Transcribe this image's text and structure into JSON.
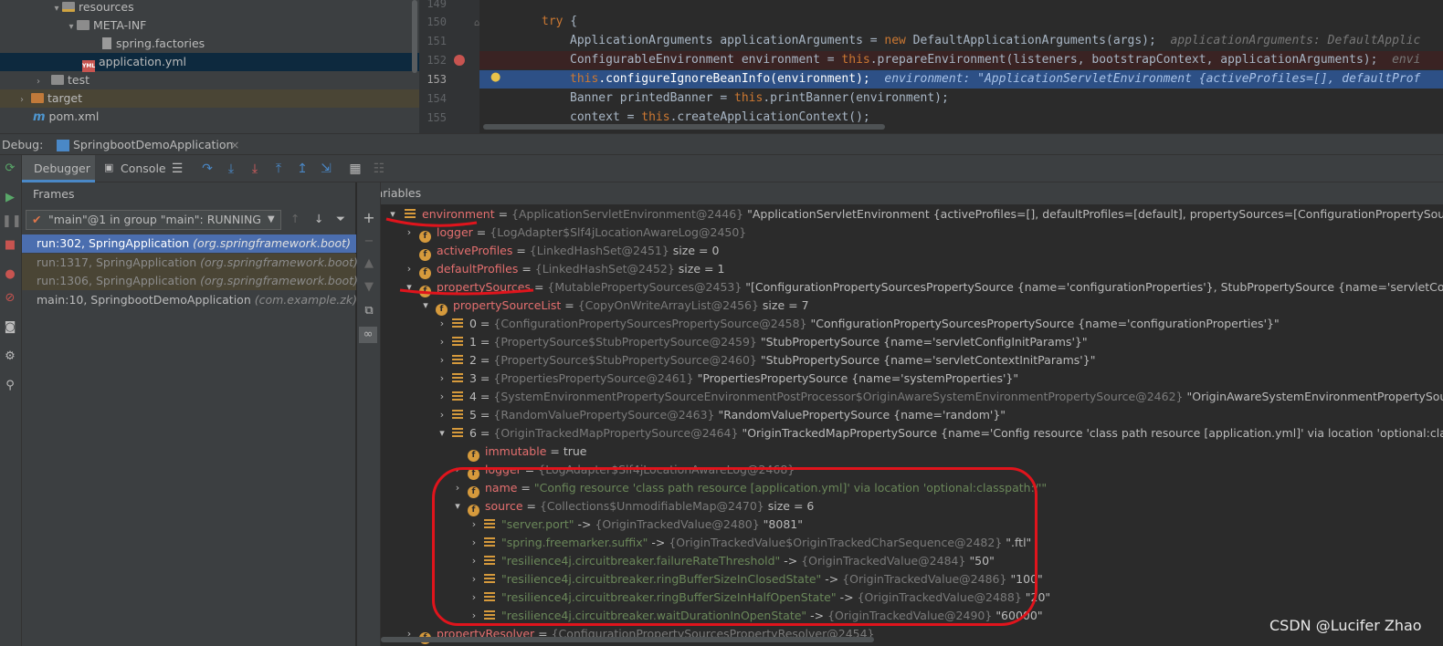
{
  "project_tree": {
    "resources": "resources",
    "meta_inf": "META-INF",
    "spring_factories": "spring.factories",
    "application_yml": "application.yml",
    "test": "test",
    "target": "target",
    "pom": "pom.xml"
  },
  "editor": {
    "lines": [
      "149",
      "150",
      "151",
      "152",
      "153",
      "154",
      "155"
    ],
    "code": {
      "l150_kw": "try",
      "l150_rest": " {",
      "l151": "ApplicationArguments applicationArguments = ",
      "l151_new": "new",
      "l151_rest": " DefaultApplicationArguments(args);",
      "l151_hint": "  applicationArguments: DefaultApplic",
      "l152": "ConfigurableEnvironment environment = ",
      "l152_this": "this",
      "l152_rest": ".prepareEnvironment(listeners, bootstrapContext, applicationArguments);",
      "l152_hint": "  envi",
      "l153_this": "this",
      "l153_rest": ".configureIgnoreBeanInfo(environment);",
      "l153_hint": "  environment: \"ApplicationServletEnvironment {activeProfiles=[], defaultProf",
      "l154": "Banner printedBanner = ",
      "l154_this": "this",
      "l154_rest": ".printBanner(environment);",
      "l155": "context = ",
      "l155_this": "this",
      "l155_rest": ".createApplicationContext();"
    }
  },
  "debug": {
    "label": "Debug:",
    "tab": "SpringbootDemoApplication",
    "debugger_tab": "Debugger",
    "console_tab": "Console"
  },
  "frames": {
    "header": "Frames",
    "thread": "\"main\"@1 in group \"main\": RUNNING",
    "items": [
      {
        "method": "run:302, SpringApplication",
        "pkg": "(org.springframework.boot)"
      },
      {
        "method": "run:1317, SpringApplication",
        "pkg": "(org.springframework.boot)"
      },
      {
        "method": "run:1306, SpringApplication",
        "pkg": "(org.springframework.boot)"
      },
      {
        "method": "main:10, SpringbootDemoApplication",
        "pkg": "(com.example.zk)"
      }
    ]
  },
  "variables": {
    "header": "Variables",
    "rows": [
      {
        "name": "environment",
        "type": "{ApplicationServletEnvironment@2446}",
        "value": "\"ApplicationServletEnvironment {activeProfiles=[], defaultProfiles=[default], propertySources=[ConfigurationPropertySourcesPropertySourc"
      },
      {
        "name": "logger",
        "type": "{LogAdapter$Slf4jLocationAwareLog@2450}",
        "value": ""
      },
      {
        "name": "activeProfiles",
        "type": "{LinkedHashSet@2451}",
        "value": " size = 0"
      },
      {
        "name": "defaultProfiles",
        "type": "{LinkedHashSet@2452}",
        "value": " size = 1"
      },
      {
        "name": "propertySources",
        "type": "{MutablePropertySources@2453}",
        "value": "\"[ConfigurationPropertySourcesPropertySource {name='configurationProperties'}, StubPropertySource {name='servletConfigInitParams'}"
      },
      {
        "name": "propertySourceList",
        "type": "{CopyOnWriteArrayList@2456}",
        "value": " size = 7"
      },
      {
        "name": "0",
        "type": "{ConfigurationPropertySourcesPropertySource@2458}",
        "value": "\"ConfigurationPropertySourcesPropertySource {name='configurationProperties'}\""
      },
      {
        "name": "1",
        "type": "{PropertySource$StubPropertySource@2459}",
        "value": "\"StubPropertySource {name='servletConfigInitParams'}\""
      },
      {
        "name": "2",
        "type": "{PropertySource$StubPropertySource@2460}",
        "value": "\"StubPropertySource {name='servletContextInitParams'}\""
      },
      {
        "name": "3",
        "type": "{PropertiesPropertySource@2461}",
        "value": "\"PropertiesPropertySource {name='systemProperties'}\""
      },
      {
        "name": "4",
        "type": "{SystemEnvironmentPropertySourceEnvironmentPostProcessor$OriginAwareSystemEnvironmentPropertySource@2462}",
        "value": "\"OriginAwareSystemEnvironmentPropertySource {name='sys"
      },
      {
        "name": "5",
        "type": "{RandomValuePropertySource@2463}",
        "value": "\"RandomValuePropertySource {name='random'}\""
      },
      {
        "name": "6",
        "type": "{OriginTrackedMapPropertySource@2464}",
        "value": "\"OriginTrackedMapPropertySource {name='Config resource 'class path resource [application.yml]' via location 'optional:classpath:/'}\""
      },
      {
        "name": "immutable",
        "type": "",
        "value": "true"
      },
      {
        "name": "logger",
        "type": "{LogAdapter$Slf4jLocationAwareLog@2468}",
        "value": ""
      },
      {
        "name": "name",
        "type": "",
        "value": "\"Config resource 'class path resource [application.yml]' via location 'optional:classpath:/'\""
      },
      {
        "name": "source",
        "type": "{Collections$UnmodifiableMap@2470}",
        "value": " size = 6"
      },
      {
        "name": "\"server.port\"",
        "type": "{OriginTrackedValue@2480}",
        "value": "\"8081\""
      },
      {
        "name": "\"spring.freemarker.suffix\"",
        "type": "{OriginTrackedValue$OriginTrackedCharSequence@2482}",
        "value": "\".ftl\""
      },
      {
        "name": "\"resilience4j.circuitbreaker.failureRateThreshold\"",
        "type": "{OriginTrackedValue@2484}",
        "value": "\"50\""
      },
      {
        "name": "\"resilience4j.circuitbreaker.ringBufferSizeInClosedState\"",
        "type": "{OriginTrackedValue@2486}",
        "value": "\"100\""
      },
      {
        "name": "\"resilience4j.circuitbreaker.ringBufferSizeInHalfOpenState\"",
        "type": "{OriginTrackedValue@2488}",
        "value": "\"20\""
      },
      {
        "name": "\"resilience4j.circuitbreaker.waitDurationInOpenState\"",
        "type": "{OriginTrackedValue@2490}",
        "value": "\"60000\""
      },
      {
        "name": "propertyResolver",
        "type": "{ConfigurationPropertySourcesPropertyResolver@2454}",
        "value": ""
      }
    ]
  },
  "watermark": "CSDN @Lucifer Zhao",
  "colors": {
    "annotation": "#e0141c",
    "selected_frame": "#4b6eaf",
    "field_icon": "#d69a3c"
  }
}
